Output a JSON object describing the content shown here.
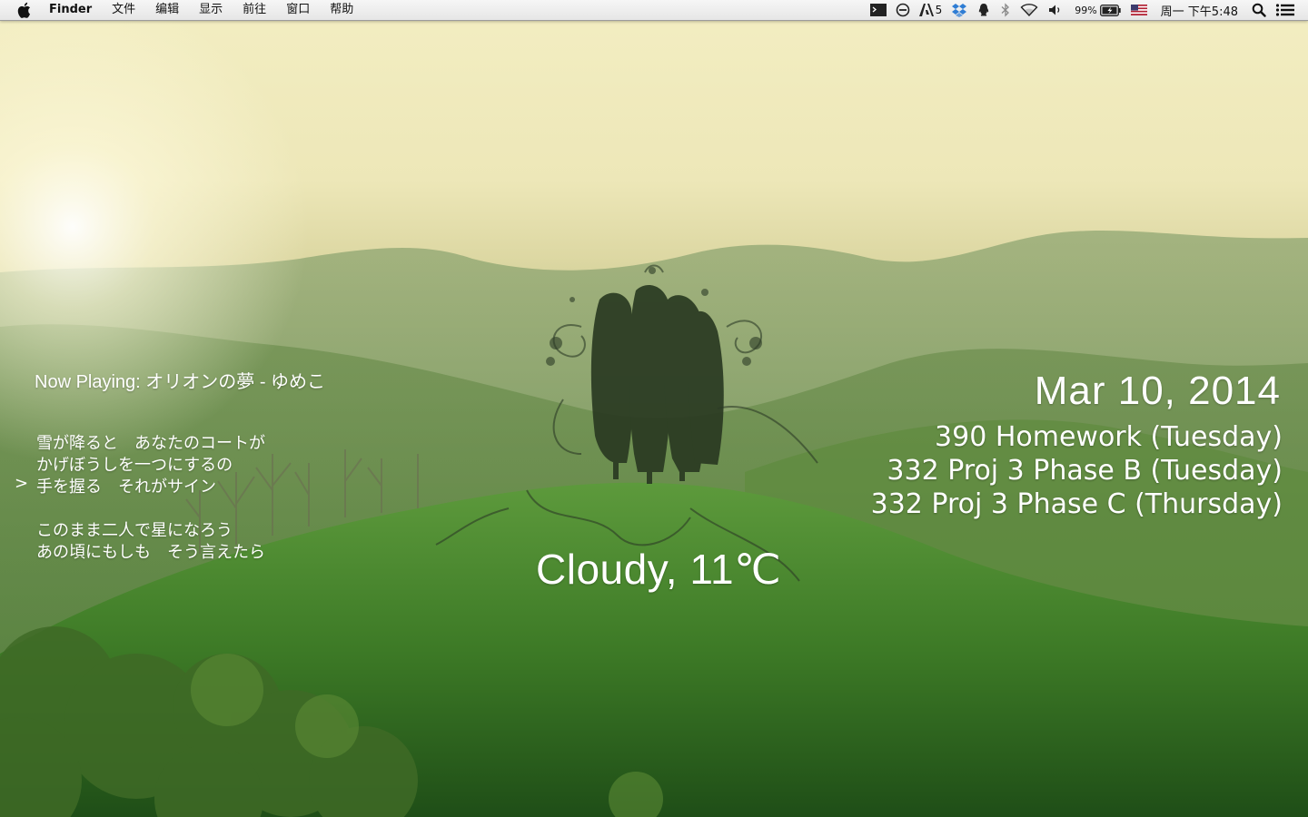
{
  "menubar": {
    "app_name": "Finder",
    "menus": [
      "文件",
      "编辑",
      "显示",
      "前往",
      "窗口",
      "帮助"
    ],
    "status": {
      "adobe_count": "5",
      "battery": "99%",
      "clock": "周一 下午5:48"
    },
    "icons": [
      "apple-icon",
      "terminal-icon",
      "stop-icon",
      "adobe-icon",
      "dropbox-icon",
      "qq-icon",
      "bluetooth-icon",
      "wifi-icon",
      "volume-icon",
      "battery-icon",
      "flag-icon",
      "spotlight-icon",
      "notification-center-icon"
    ]
  },
  "music": {
    "now_playing": "Now Playing: オリオンの夢 - ゆめこ",
    "current_marker": ">",
    "lyrics": [
      "雪が降ると　あなたのコートが",
      "かげぼうしを一つにするの",
      "手を握る　それがサイン",
      "このまま二人で星になろう",
      "あの頃にもしも　そう言えたら"
    ]
  },
  "calendar": {
    "date": "Mar 10, 2014",
    "todos": [
      "390 Homework (Tuesday)",
      "332 Proj 3 Phase B (Tuesday)",
      "332 Proj 3 Phase C (Thursday)"
    ]
  },
  "weather": {
    "text": "Cloudy, 11℃"
  }
}
